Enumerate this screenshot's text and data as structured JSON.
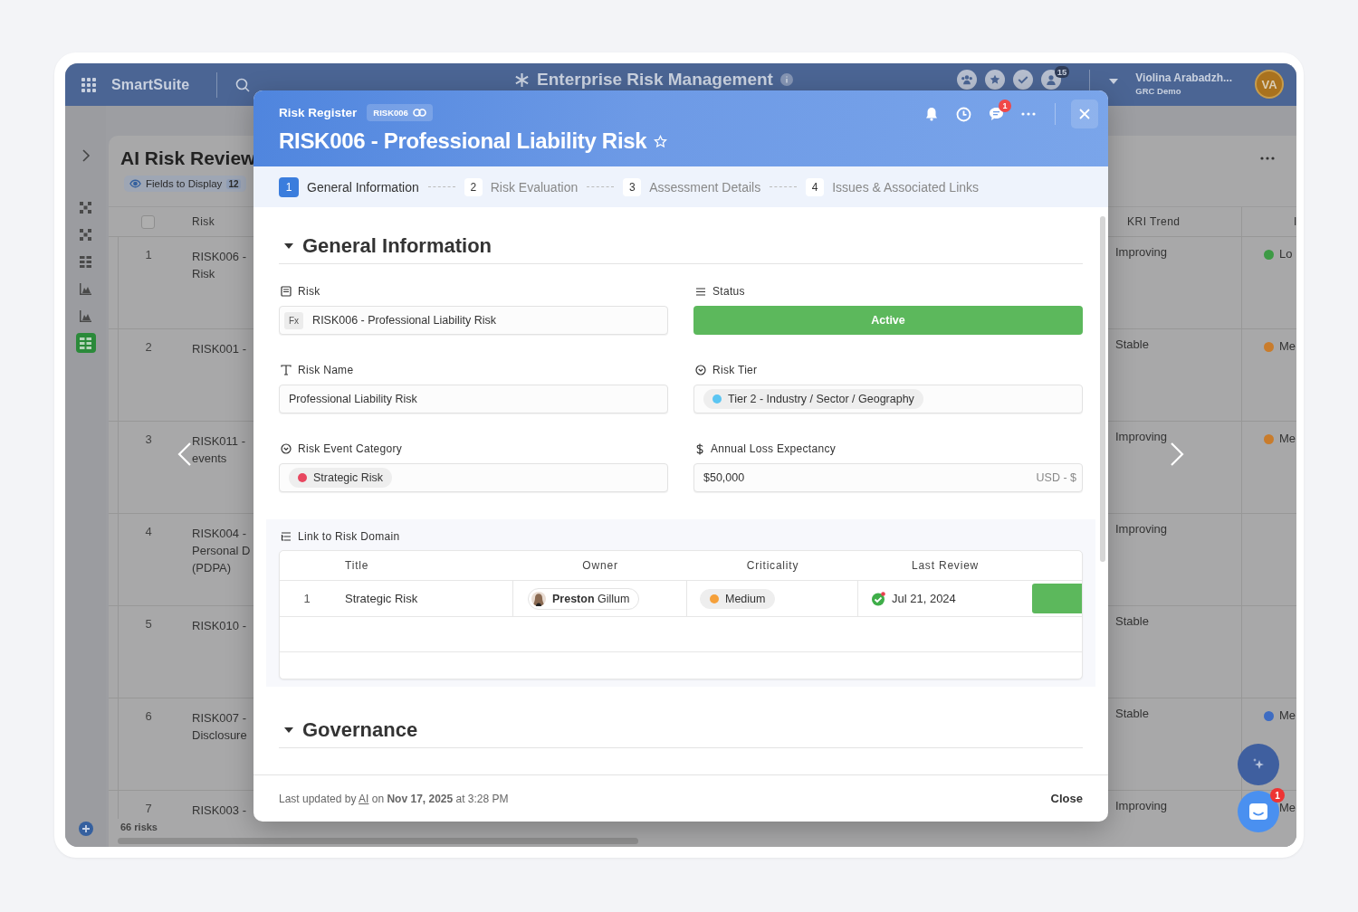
{
  "app": {
    "brand": "SmartSuite",
    "workspace": "Enterprise Risk Management",
    "notification_count": "15",
    "user": {
      "name": "Violina Arabadzh...",
      "org": "GRC Demo",
      "initials": "VA"
    }
  },
  "rail": [
    {
      "kind": "dots",
      "selected": false
    },
    {
      "kind": "dots",
      "selected": false
    },
    {
      "kind": "grid",
      "selected": false
    },
    {
      "kind": "chart",
      "selected": false
    },
    {
      "kind": "chart",
      "selected": false
    },
    {
      "kind": "grid",
      "selected": true
    }
  ],
  "view": {
    "title": "AI Risk Review",
    "fields_button": "Fields to Display",
    "fields_count": "12",
    "select_all": {
      "checked": false
    },
    "columns": [
      "Risk",
      "KRI Trend",
      "I"
    ],
    "rows": [
      {
        "number": "1",
        "risk": [
          "RISK006 -",
          "Risk"
        ],
        "trend": "Improving",
        "impact": {
          "label": "Lo",
          "color": "#3d9a45"
        }
      },
      {
        "number": "2",
        "risk": [
          "RISK001 -"
        ],
        "trend": "Stable",
        "impact": {
          "label": "Me",
          "color": "#c97c2c"
        }
      },
      {
        "number": "3",
        "risk": [
          "RISK011 -",
          "events"
        ],
        "trend": "Improving",
        "impact": {
          "label": "Me",
          "color": "#c97c2c"
        }
      },
      {
        "number": "4",
        "risk": [
          "RISK004 -",
          "Personal D",
          "(PDPA)"
        ],
        "trend": "Improving"
      },
      {
        "number": "5",
        "risk": [
          "RISK010 -"
        ],
        "trend": "Stable"
      },
      {
        "number": "6",
        "risk": [
          "RISK007 -",
          "Disclosure"
        ],
        "trend": "Stable",
        "impact": {
          "label": "Me",
          "color": "#3e6cc2"
        }
      },
      {
        "number": "7",
        "risk": [
          "RISK003 -"
        ],
        "trend": "Improving",
        "impact": {
          "label": "Me"
        }
      }
    ],
    "record_count": "66 risks"
  },
  "chat_badge": "1",
  "record": {
    "breadcrumb": "Risk Register",
    "record_id": "RISK006",
    "title": "RISK006 - Professional Liability Risk",
    "comment_count": "1",
    "steps": [
      {
        "number": "1",
        "label": "General Information",
        "selected": true
      },
      {
        "number": "2",
        "label": "Risk Evaluation",
        "selected": false
      },
      {
        "number": "3",
        "label": "Assessment Details",
        "selected": false
      },
      {
        "number": "4",
        "label": "Issues & Associated Links",
        "selected": false
      }
    ],
    "sections": [
      {
        "title": "General Information",
        "expanded": true
      },
      {
        "title": "Governance",
        "expanded": true
      }
    ],
    "fields": [
      {
        "kind": "formula",
        "label": "Risk",
        "badge": "Fx",
        "value": "RISK006 - Professional Liability Risk"
      },
      {
        "kind": "status",
        "label": "Status",
        "value": "Active",
        "color": "#5cb85c"
      },
      {
        "kind": "text",
        "label": "Risk Name",
        "value": "Professional Liability Risk"
      },
      {
        "kind": "select",
        "label": "Risk Tier",
        "value": "Tier 2 - Industry / Sector / Geography",
        "color": "#5bc5f2"
      },
      {
        "kind": "select",
        "label": "Risk Event Category",
        "value": "Strategic Risk",
        "color": "#e8465f"
      },
      {
        "kind": "currency",
        "label": "Annual Loss Expectancy",
        "value": "$50,000",
        "suffix": "USD - $"
      }
    ],
    "linked": {
      "label": "Link to Risk Domain",
      "columns": [
        "Title",
        "Owner",
        "Criticality",
        "Last Review"
      ],
      "rows": [
        {
          "number": "1",
          "title": "Strategic Risk",
          "owner": "**Preston** Gillum",
          "criticality": {
            "label": "Medium",
            "color": "#f5a03a"
          },
          "last_review": "Jul 21, 2024",
          "reviewed": true
        }
      ]
    },
    "footer": {
      "prefix": "Last updated by",
      "author": "AI",
      "suffix": "on **Nov 17, 2025** at 3:28 PM",
      "close": "Close"
    }
  }
}
